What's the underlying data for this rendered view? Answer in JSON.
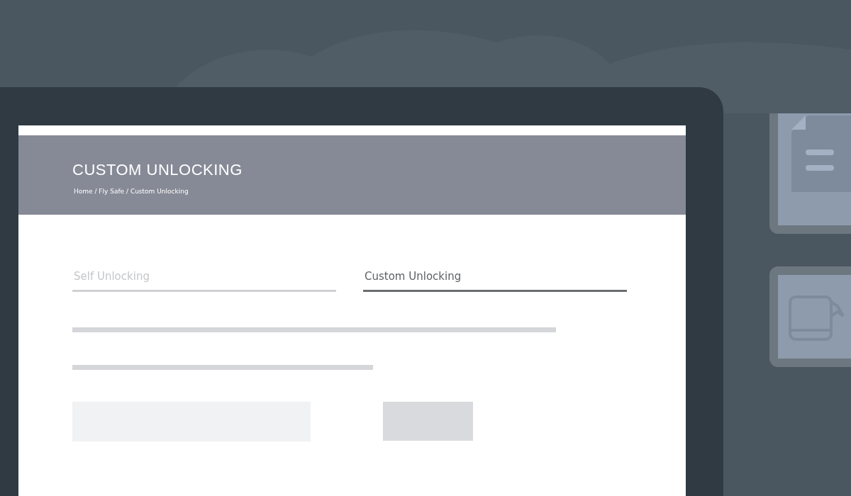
{
  "page_header": {
    "title": "CUSTOM UNLOCKING",
    "breadcrumb": "Home / Fly Safe / Custom Unlocking"
  },
  "tabs": [
    {
      "label": "Self Unlocking",
      "selected": false
    },
    {
      "label": "Custom Unlocking",
      "selected": true
    }
  ]
}
